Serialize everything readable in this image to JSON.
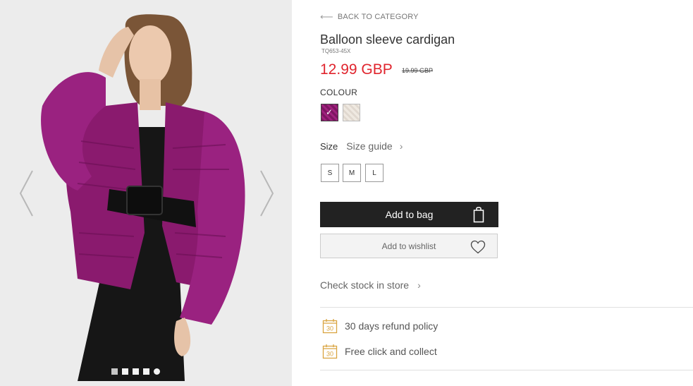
{
  "gallery": {
    "prev_label": "previous image",
    "next_label": "next image",
    "dot_count": 5
  },
  "product": {
    "back_link": "BACK TO CATEGORY",
    "title": "Balloon sleeve cardigan",
    "sku": "TQ653-45X",
    "price": "12.99 GBP",
    "old_price": "19.99 GBP",
    "colour_label": "COLOUR",
    "colours": [
      "purple",
      "cream"
    ],
    "selected_colour": "purple",
    "size_label": "Size",
    "size_guide": "Size guide",
    "sizes": [
      "S",
      "M",
      "L"
    ],
    "add_to_bag": "Add to bag",
    "add_to_wishlist": "Add to wishlist",
    "check_stock": "Check stock in store"
  },
  "perks": [
    {
      "icon": "calendar-icon",
      "icon_number": "30",
      "text": "30 days refund policy"
    },
    {
      "icon": "calendar-icon",
      "icon_number": "30",
      "text": "Free click and collect"
    }
  ],
  "colors": {
    "price_red": "#e0242d",
    "button_dark": "#222222",
    "perk_icon": "#d9a441",
    "product_purple": "#8a1a6e"
  }
}
